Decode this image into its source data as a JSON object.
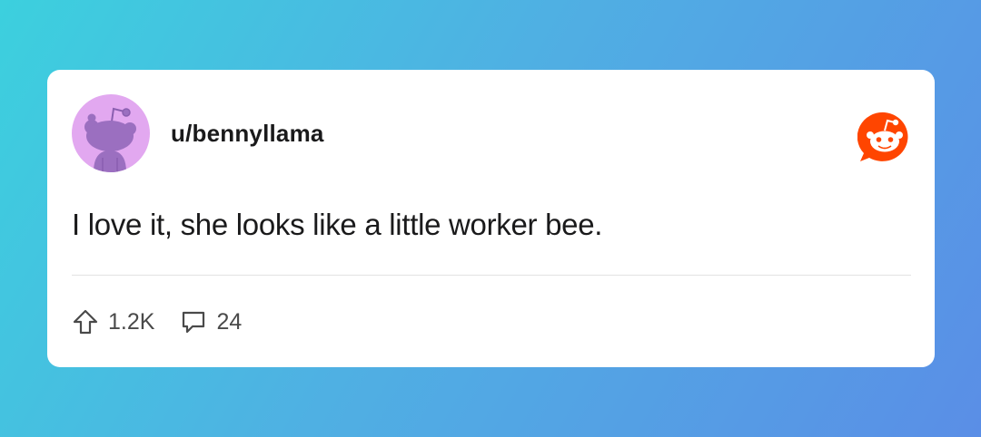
{
  "post": {
    "username": "u/bennyllama",
    "text": "I love it, she looks like a little worker bee.",
    "upvotes": "1.2K",
    "comments": "24"
  },
  "icons": {
    "avatar": "snoo-avatar",
    "brand": "reddit-logo-icon",
    "upvote": "upvote-arrow-icon",
    "comment": "comment-bubble-icon"
  },
  "colors": {
    "avatar_bg": "#e2a8f0",
    "snoo": "#9b6fc0",
    "brand": "#ff4500",
    "text": "#1a1a1b",
    "muted": "#4a4a4a"
  }
}
